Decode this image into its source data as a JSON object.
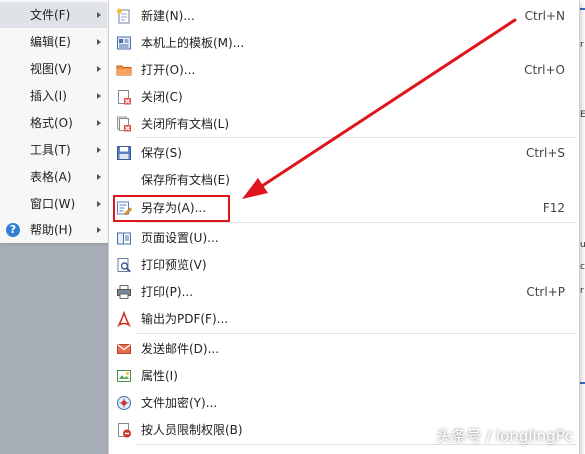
{
  "main_menu": {
    "items": [
      {
        "label": "文件(F)",
        "active": true
      },
      {
        "label": "编辑(E)"
      },
      {
        "label": "视图(V)"
      },
      {
        "label": "插入(I)"
      },
      {
        "label": "格式(O)"
      },
      {
        "label": "工具(T)"
      },
      {
        "label": "表格(A)"
      },
      {
        "label": "窗口(W)"
      },
      {
        "label": "帮助(H)",
        "icon": "help-icon"
      }
    ],
    "help_glyph": "?"
  },
  "file_menu": {
    "items": [
      {
        "label": "新建(N)...",
        "shortcut": "Ctrl+N",
        "icon": "new-document-icon"
      },
      {
        "label": "本机上的模板(M)...",
        "shortcut": "",
        "icon": "template-icon"
      },
      {
        "label": "打开(O)...",
        "shortcut": "Ctrl+O",
        "icon": "open-folder-icon"
      },
      {
        "label": "关闭(C)",
        "shortcut": "",
        "icon": "close-document-icon"
      },
      {
        "label": "关闭所有文档(L)",
        "shortcut": "",
        "icon": "close-all-icon"
      },
      {
        "label": "保存(S)",
        "shortcut": "Ctrl+S",
        "icon": "save-icon"
      },
      {
        "label": "保存所有文档(E)",
        "shortcut": "",
        "icon": ""
      },
      {
        "label": "另存为(A)...",
        "shortcut": "F12",
        "icon": "save-as-icon"
      },
      {
        "label": "页面设置(U)...",
        "shortcut": "",
        "icon": "page-setup-icon"
      },
      {
        "label": "打印预览(V)",
        "shortcut": "",
        "icon": "print-preview-icon"
      },
      {
        "label": "打印(P)...",
        "shortcut": "Ctrl+P",
        "icon": "printer-icon"
      },
      {
        "label": "输出为PDF(F)...",
        "shortcut": "",
        "icon": "pdf-icon"
      },
      {
        "label": "发送邮件(D)...",
        "shortcut": "",
        "icon": "mail-icon"
      },
      {
        "label": "属性(I)",
        "shortcut": "",
        "icon": "properties-icon"
      },
      {
        "label": "文件加密(Y)...",
        "shortcut": "",
        "icon": "encrypt-icon"
      },
      {
        "label": "按人员限制权限(B)",
        "shortcut": "",
        "icon": "permission-icon"
      }
    ]
  },
  "background_doc": {
    "chars": [
      "r",
      "E",
      "u",
      "c",
      "r"
    ]
  },
  "annotation": {
    "highlighted_item": "另存为(A)...",
    "color": "#e0141c"
  },
  "watermark": "头条号 / longlingPc",
  "colors": {
    "menu_bg": "#f7f7f7",
    "submenu_bg": "#ffffff",
    "accent_red": "#e0141c",
    "help_blue": "#2f7fd3"
  }
}
